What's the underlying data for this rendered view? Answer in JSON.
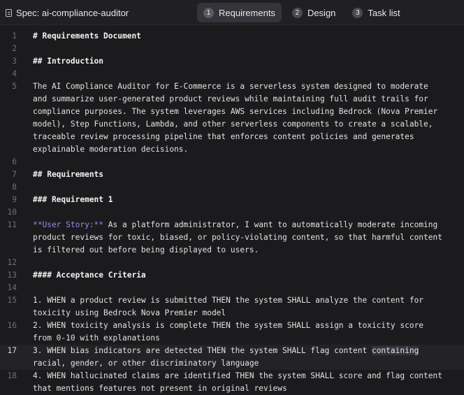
{
  "header": {
    "spec_title": "Spec: ai-compliance-auditor",
    "icon": "document-icon",
    "tabs": [
      {
        "num": "1",
        "label": "Requirements",
        "active": true
      },
      {
        "num": "2",
        "label": "Design",
        "active": false
      },
      {
        "num": "3",
        "label": "Task list",
        "active": false
      }
    ]
  },
  "editor": {
    "current_line": 17,
    "lines": [
      {
        "n": "1",
        "text": "# Requirements Document"
      },
      {
        "n": "2",
        "text": ""
      },
      {
        "n": "3",
        "text": "## Introduction"
      },
      {
        "n": "4",
        "text": ""
      },
      {
        "n": "5",
        "text": "The AI Compliance Auditor for E-Commerce is a serverless system designed to moderate"
      },
      {
        "n": "",
        "text": "and summarize user-generated product reviews while maintaining full audit trails for"
      },
      {
        "n": "",
        "text": "compliance purposes. The system leverages AWS services including Bedrock (Nova Premier"
      },
      {
        "n": "",
        "text": "model), Step Functions, Lambda, and other serverless components to create a scalable,"
      },
      {
        "n": "",
        "text": "traceable review processing pipeline that enforces content policies and generates"
      },
      {
        "n": "",
        "text": "explainable moderation decisions."
      },
      {
        "n": "6",
        "text": ""
      },
      {
        "n": "7",
        "text": "## Requirements"
      },
      {
        "n": "8",
        "text": ""
      },
      {
        "n": "9",
        "text": "### Requirement 1"
      },
      {
        "n": "10",
        "text": ""
      },
      {
        "n": "11",
        "bold_marker": "**User Story:**",
        "text": " As a platform administrator, I want to automatically moderate incoming"
      },
      {
        "n": "",
        "text": "product reviews for toxic, biased, or policy-violating content, so that harmful content"
      },
      {
        "n": "",
        "text": "is filtered out before being displayed to users."
      },
      {
        "n": "12",
        "text": ""
      },
      {
        "n": "13",
        "text": "#### Acceptance Criteria"
      },
      {
        "n": "14",
        "text": ""
      },
      {
        "n": "15",
        "text": "1. WHEN a product review is submitted THEN the system SHALL analyze the content for"
      },
      {
        "n": "",
        "text": "toxicity using Bedrock Nova Premier model"
      },
      {
        "n": "16",
        "text": "2. WHEN toxicity analysis is complete THEN the system SHALL assign a toxicity score"
      },
      {
        "n": "",
        "text": "from 0-10 with explanations"
      },
      {
        "n": "17",
        "text_before": "3. WHEN bias indicators are detected THEN the system SHALL flag content ",
        "selected": "containing",
        "text": ""
      },
      {
        "n": "",
        "text": "racial, gender, or other discriminatory language"
      },
      {
        "n": "18",
        "text": "4. WHEN hallucinated claims are identified THEN the system SHALL score and flag content"
      },
      {
        "n": "",
        "text": "that mentions features not present in original reviews"
      }
    ]
  }
}
